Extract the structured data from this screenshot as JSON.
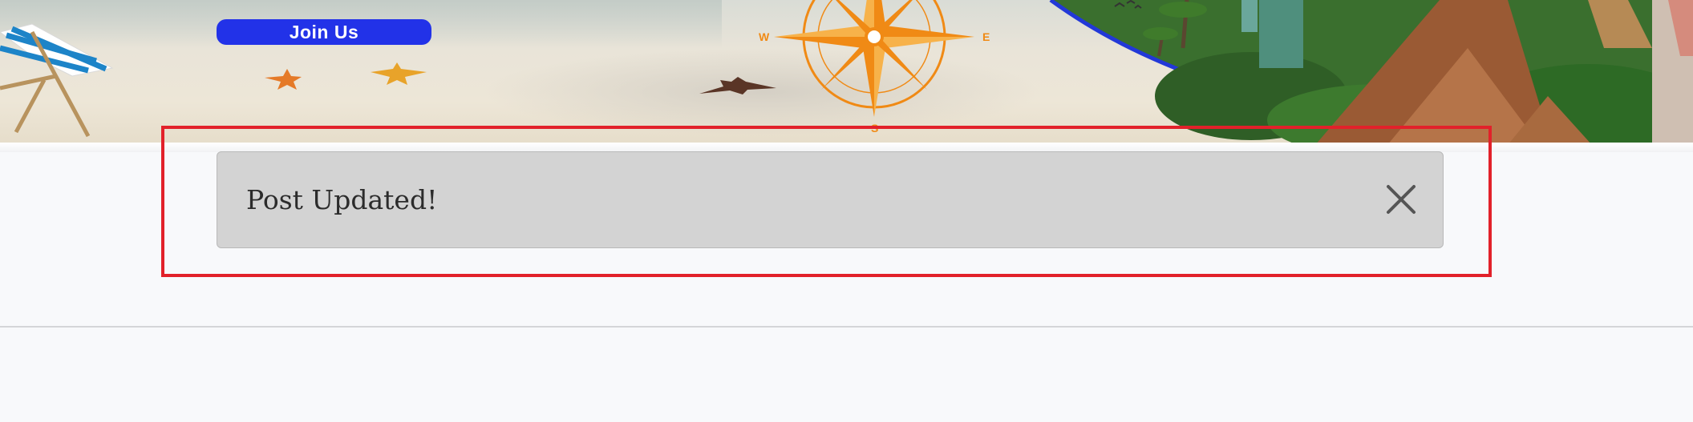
{
  "banner": {
    "join_button_label": "Join Us",
    "compass": {
      "west": "W",
      "east": "E",
      "south": "S"
    }
  },
  "alert": {
    "message": "Post Updated!",
    "close_icon": "close-icon"
  },
  "colors": {
    "join_button": "#2232e8",
    "alert_background": "#d3d3d3",
    "highlight_frame": "#e2212a",
    "page_background": "#f8f9fb"
  }
}
